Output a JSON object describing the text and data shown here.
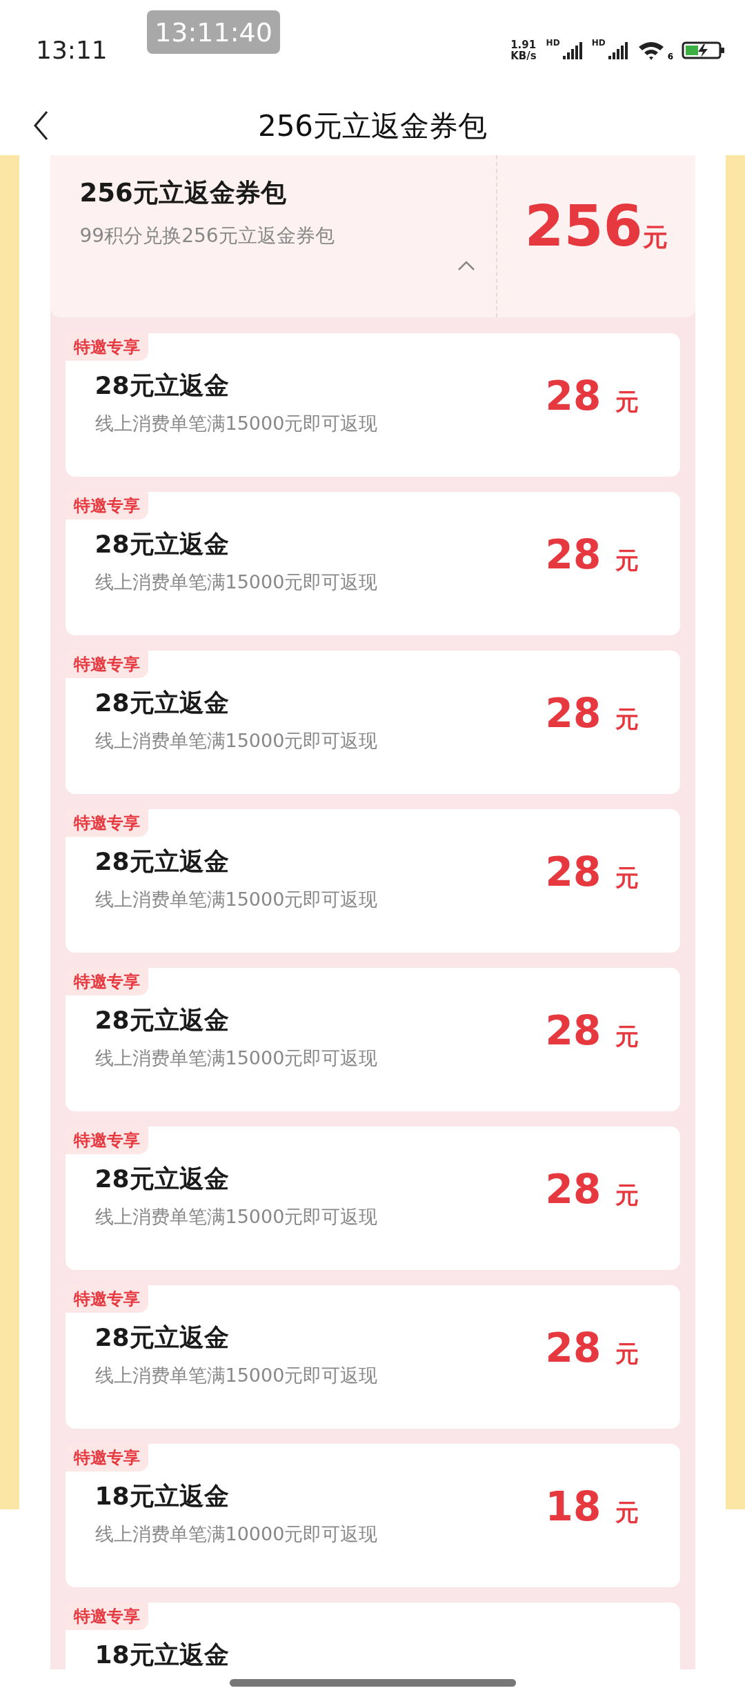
{
  "status_bar": {
    "time": "13:11",
    "timestamp": "13:11:40",
    "net_speed": [
      "1.91",
      "KB/s"
    ],
    "sim_labels": [
      "HD",
      "HD"
    ],
    "wifi_label": "6"
  },
  "nav": {
    "title": "256元立返金券包"
  },
  "package": {
    "title": "256元立返金券包",
    "description": "99积分兑换256元立返金券包",
    "amount": "256",
    "unit": "元",
    "expanded": true
  },
  "coupons": [
    {
      "badge": "特邀专享",
      "title": "28元立返金",
      "description": "线上消费单笔满15000元即可返现",
      "amount": "28",
      "unit": "元"
    },
    {
      "badge": "特邀专享",
      "title": "28元立返金",
      "description": "线上消费单笔满15000元即可返现",
      "amount": "28",
      "unit": "元"
    },
    {
      "badge": "特邀专享",
      "title": "28元立返金",
      "description": "线上消费单笔满15000元即可返现",
      "amount": "28",
      "unit": "元"
    },
    {
      "badge": "特邀专享",
      "title": "28元立返金",
      "description": "线上消费单笔满15000元即可返现",
      "amount": "28",
      "unit": "元"
    },
    {
      "badge": "特邀专享",
      "title": "28元立返金",
      "description": "线上消费单笔满15000元即可返现",
      "amount": "28",
      "unit": "元"
    },
    {
      "badge": "特邀专享",
      "title": "28元立返金",
      "description": "线上消费单笔满15000元即可返现",
      "amount": "28",
      "unit": "元"
    },
    {
      "badge": "特邀专享",
      "title": "28元立返金",
      "description": "线上消费单笔满15000元即可返现",
      "amount": "28",
      "unit": "元"
    },
    {
      "badge": "特邀专享",
      "title": "18元立返金",
      "description": "线上消费单笔满10000元即可返现",
      "amount": "18",
      "unit": "元"
    },
    {
      "badge": "特邀专享",
      "title": "18元立返金"
    }
  ]
}
